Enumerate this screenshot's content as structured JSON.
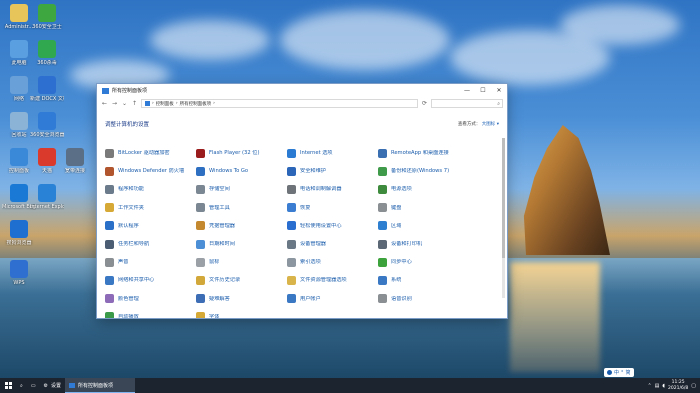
{
  "colors": {
    "accent": "#1a5cab",
    "taskbar": "#1c2430",
    "window_title_icon": "#2f7bd6"
  },
  "desktop_icons": [
    {
      "label": "Administr...",
      "icon": "user-folder-icon"
    },
    {
      "label": "360安全卫士",
      "icon": "360-security-icon"
    },
    {
      "label": "此电脑",
      "icon": "computer-icon"
    },
    {
      "label": "360杀毒",
      "icon": "360-antivirus-icon"
    },
    {
      "label": "网络",
      "icon": "network-icon"
    },
    {
      "label": "新建 DOCX 文档.docx",
      "icon": "word-document-icon"
    },
    {
      "label": "回收站",
      "icon": "recycle-bin-icon"
    },
    {
      "label": "360安全浏览器",
      "icon": "360-browser-icon"
    },
    {
      "label": "控制面板",
      "icon": "control-panel-icon"
    },
    {
      "label": "天猫",
      "icon": "tmall-icon"
    },
    {
      "label": "宽带连接",
      "icon": "broadband-icon"
    },
    {
      "label": "Microsoft Edge",
      "icon": "edge-icon"
    },
    {
      "label": "Internet Explorer",
      "icon": "ie-icon"
    },
    {
      "label": "搜狗浏览器",
      "icon": "sogou-icon"
    },
    {
      "label": "WPS",
      "icon": "wps-icon"
    }
  ],
  "window": {
    "title": "所有控制面板项",
    "address": [
      "控制面板",
      "所有控制面板项"
    ],
    "search_placeholder": "",
    "heading": "调整计算机的设置",
    "view_by_label": "查看方式：",
    "view_by_value": "大图标 ▾",
    "items": [
      {
        "label": "BitLocker 驱动器加密",
        "icon": "bitlocker-icon",
        "color": "#7a7a7a"
      },
      {
        "label": "Flash Player (32 位)",
        "icon": "flash-icon",
        "color": "#9b1c1c"
      },
      {
        "label": "Internet 选项",
        "icon": "internet-options-icon",
        "color": "#2c7bd3"
      },
      {
        "label": "RemoteApp 和桌面连接",
        "icon": "remoteapp-icon",
        "color": "#3a6fb2"
      },
      {
        "label": "Windows Defender 防火墙",
        "icon": "firewall-icon",
        "color": "#b0552e"
      },
      {
        "label": "Windows To Go",
        "icon": "windows-to-go-icon",
        "color": "#2e6fc2"
      },
      {
        "label": "安全和维护",
        "icon": "flag-icon",
        "color": "#2b66b8"
      },
      {
        "label": "备份和还原(Windows 7)",
        "icon": "backup-icon",
        "color": "#3f9b4a"
      },
      {
        "label": "程序和功能",
        "icon": "programs-icon",
        "color": "#6b7b8c"
      },
      {
        "label": "存储空间",
        "icon": "storage-spaces-icon",
        "color": "#7b8792"
      },
      {
        "label": "电话和调制解调器",
        "icon": "phone-modem-icon",
        "color": "#6d7378"
      },
      {
        "label": "电源选项",
        "icon": "power-options-icon",
        "color": "#3e8b3e"
      },
      {
        "label": "工作文件夹",
        "icon": "work-folders-icon",
        "color": "#d6a936"
      },
      {
        "label": "管理工具",
        "icon": "admin-tools-icon",
        "color": "#7b8792"
      },
      {
        "label": "恢复",
        "icon": "recovery-icon",
        "color": "#3b7dd0"
      },
      {
        "label": "键盘",
        "icon": "keyboard-icon",
        "color": "#8a8f94"
      },
      {
        "label": "默认程序",
        "icon": "default-programs-icon",
        "color": "#2a70c8"
      },
      {
        "label": "凭据管理器",
        "icon": "credential-manager-icon",
        "color": "#c4892f"
      },
      {
        "label": "轻松使用设置中心",
        "icon": "ease-of-access-icon",
        "color": "#2a6fd0"
      },
      {
        "label": "区域",
        "icon": "region-icon",
        "color": "#2f7fd0"
      },
      {
        "label": "任务栏和导航",
        "icon": "taskbar-nav-icon",
        "color": "#4b5d73"
      },
      {
        "label": "日期和时间",
        "icon": "date-time-icon",
        "color": "#4d8fd6"
      },
      {
        "label": "设备管理器",
        "icon": "device-manager-icon",
        "color": "#6a7886"
      },
      {
        "label": "设备和打印机",
        "icon": "devices-printers-icon",
        "color": "#5b6775"
      },
      {
        "label": "声音",
        "icon": "sound-icon",
        "color": "#8a8f94"
      },
      {
        "label": "鼠标",
        "icon": "mouse-icon",
        "color": "#9aa0a6"
      },
      {
        "label": "索引选项",
        "icon": "indexing-icon",
        "color": "#8c96a0"
      },
      {
        "label": "同步中心",
        "icon": "sync-center-icon",
        "color": "#3ca33c"
      },
      {
        "label": "网络和共享中心",
        "icon": "network-sharing-icon",
        "color": "#3a78c4"
      },
      {
        "label": "文件历史记录",
        "icon": "file-history-icon",
        "color": "#d3a83a"
      },
      {
        "label": "文件资源管理器选项",
        "icon": "explorer-options-icon",
        "color": "#d9b44a"
      },
      {
        "label": "系统",
        "icon": "system-icon",
        "color": "#3a78c4"
      },
      {
        "label": "颜色管理",
        "icon": "color-management-icon",
        "color": "#8e6bb8"
      },
      {
        "label": "疑难解答",
        "icon": "troubleshooting-icon",
        "color": "#3d6eb5"
      },
      {
        "label": "用户帐户",
        "icon": "user-accounts-icon",
        "color": "#3a78c4"
      },
      {
        "label": "语音识别",
        "icon": "speech-recognition-icon",
        "color": "#8a8f94"
      },
      {
        "label": "自动播放",
        "icon": "autoplay-icon",
        "color": "#3a9a4a"
      },
      {
        "label": "字体",
        "icon": "fonts-icon",
        "color": "#d6a936"
      }
    ]
  },
  "taskbar": {
    "settings_label": "设置",
    "active_window_label": "所有控制面板项",
    "ime": [
      "中",
      "°",
      "简"
    ],
    "time": "11:25",
    "date": "2021/6/8"
  }
}
